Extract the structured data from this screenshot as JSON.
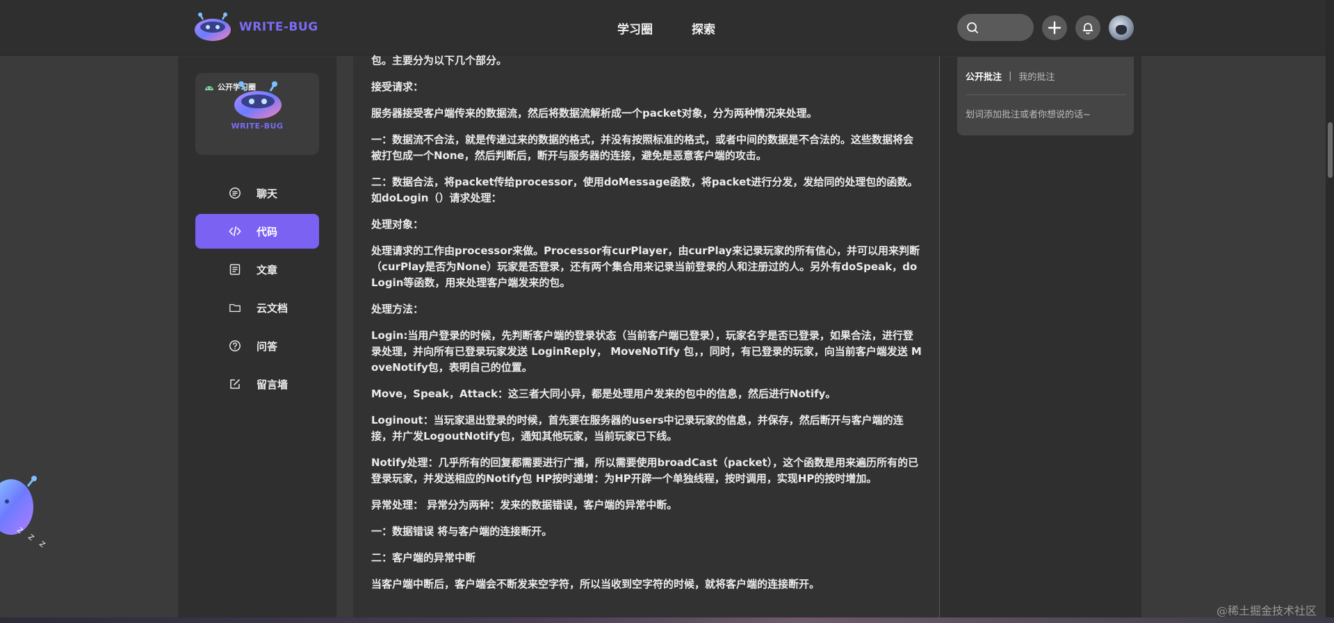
{
  "header": {
    "logo_text": "WRITE-BUG",
    "nav": [
      {
        "label": "学习圈"
      },
      {
        "label": "探索"
      }
    ],
    "icons": {
      "search": "search-icon",
      "add": "plus-icon",
      "notify": "bell-icon"
    }
  },
  "circle_card": {
    "tag": "公开学习圈",
    "brand": "WRITE-BUG"
  },
  "sidebar": {
    "items": [
      {
        "label": "聊天",
        "icon": "chat-icon",
        "active": false
      },
      {
        "label": "代码",
        "icon": "code-icon",
        "active": true
      },
      {
        "label": "文章",
        "icon": "article-icon",
        "active": false
      },
      {
        "label": "云文档",
        "icon": "folder-icon",
        "active": false
      },
      {
        "label": "问答",
        "icon": "question-icon",
        "active": false
      },
      {
        "label": "留言墙",
        "icon": "edit-icon",
        "active": false
      }
    ]
  },
  "article": {
    "paragraphs": [
      "包。主要分为以下几个部分。",
      "接受请求：",
      "服务器接受客户端传来的数据流，然后将数据流解析成一个packet对象，分为两种情况来处理。",
      "一：数据流不合法，就是传递过来的数据的格式，并没有按照标准的格式，或者中间的数据是不合法的。这些数据将会被打包成一个None，然后判断后，断开与服务器的连接，避免是恶意客户端的攻击。",
      "二：数据合法，将packet传给processor，使用doMessage函数，将packet进行分发，发给同的处理包的函数。如doLogin（）请求处理：",
      "处理对象：",
      "处理请求的工作由processor来做。Processor有curPlayer，由curPlay来记录玩家的所有信心，并可以用来判断（curPlay是否为None）玩家是否登录，还有两个集合用来记录当前登录的人和注册过的人。另外有doSpeak，doLogin等函数，用来处理客户端发来的包。",
      "处理方法：",
      "Login:当用户登录的时候，先判断客户端的登录状态（当前客户端已登录），玩家名字是否已登录，如果合法，进行登录处理，并向所有已登录玩家发送 LoginReply， MoveNoTify 包，，同时，有已登录的玩家，向当前客户端发送 MoveNotify包，表明自己的位置。",
      "Move，Speak，Attack：这三者大同小异，都是处理用户发来的包中的信息，然后进行Notify。",
      "Loginout：当玩家退出登录的时候，首先要在服务器的users中记录玩家的信息，并保存，然后断开与客户端的连接，并广发LogoutNotify包，通知其他玩家，当前玩家已下线。",
      "Notify处理：几乎所有的回复都需要进行广播，所以需要使用broadCast（packet），这个函数是用来遍历所有的已登录玩家，并发送相应的Notify包 HP按时递增：为HP开辟一个单独线程，按时调用，实现HP的按时增加。",
      "异常处理： 异常分为两种：发来的数据错误，客户端的异常中断。",
      "一：数据错误 将与客户端的连接断开。",
      "二：客户端的异常中断",
      "当客户端中断后，客户端会不断发来空字符，所以当收到空字符的时候，就将客户端的连接断开。"
    ]
  },
  "annotations": {
    "tab_public": "公开批注",
    "separator": "|",
    "tab_mine": "我的批注",
    "hint": "划词添加批注或者你想说的话~"
  },
  "watermark": "@稀土掘金技术社区",
  "colors": {
    "accent": "#7b62f2",
    "brand": "#7b6cf6",
    "background": "#3b3b3b"
  }
}
